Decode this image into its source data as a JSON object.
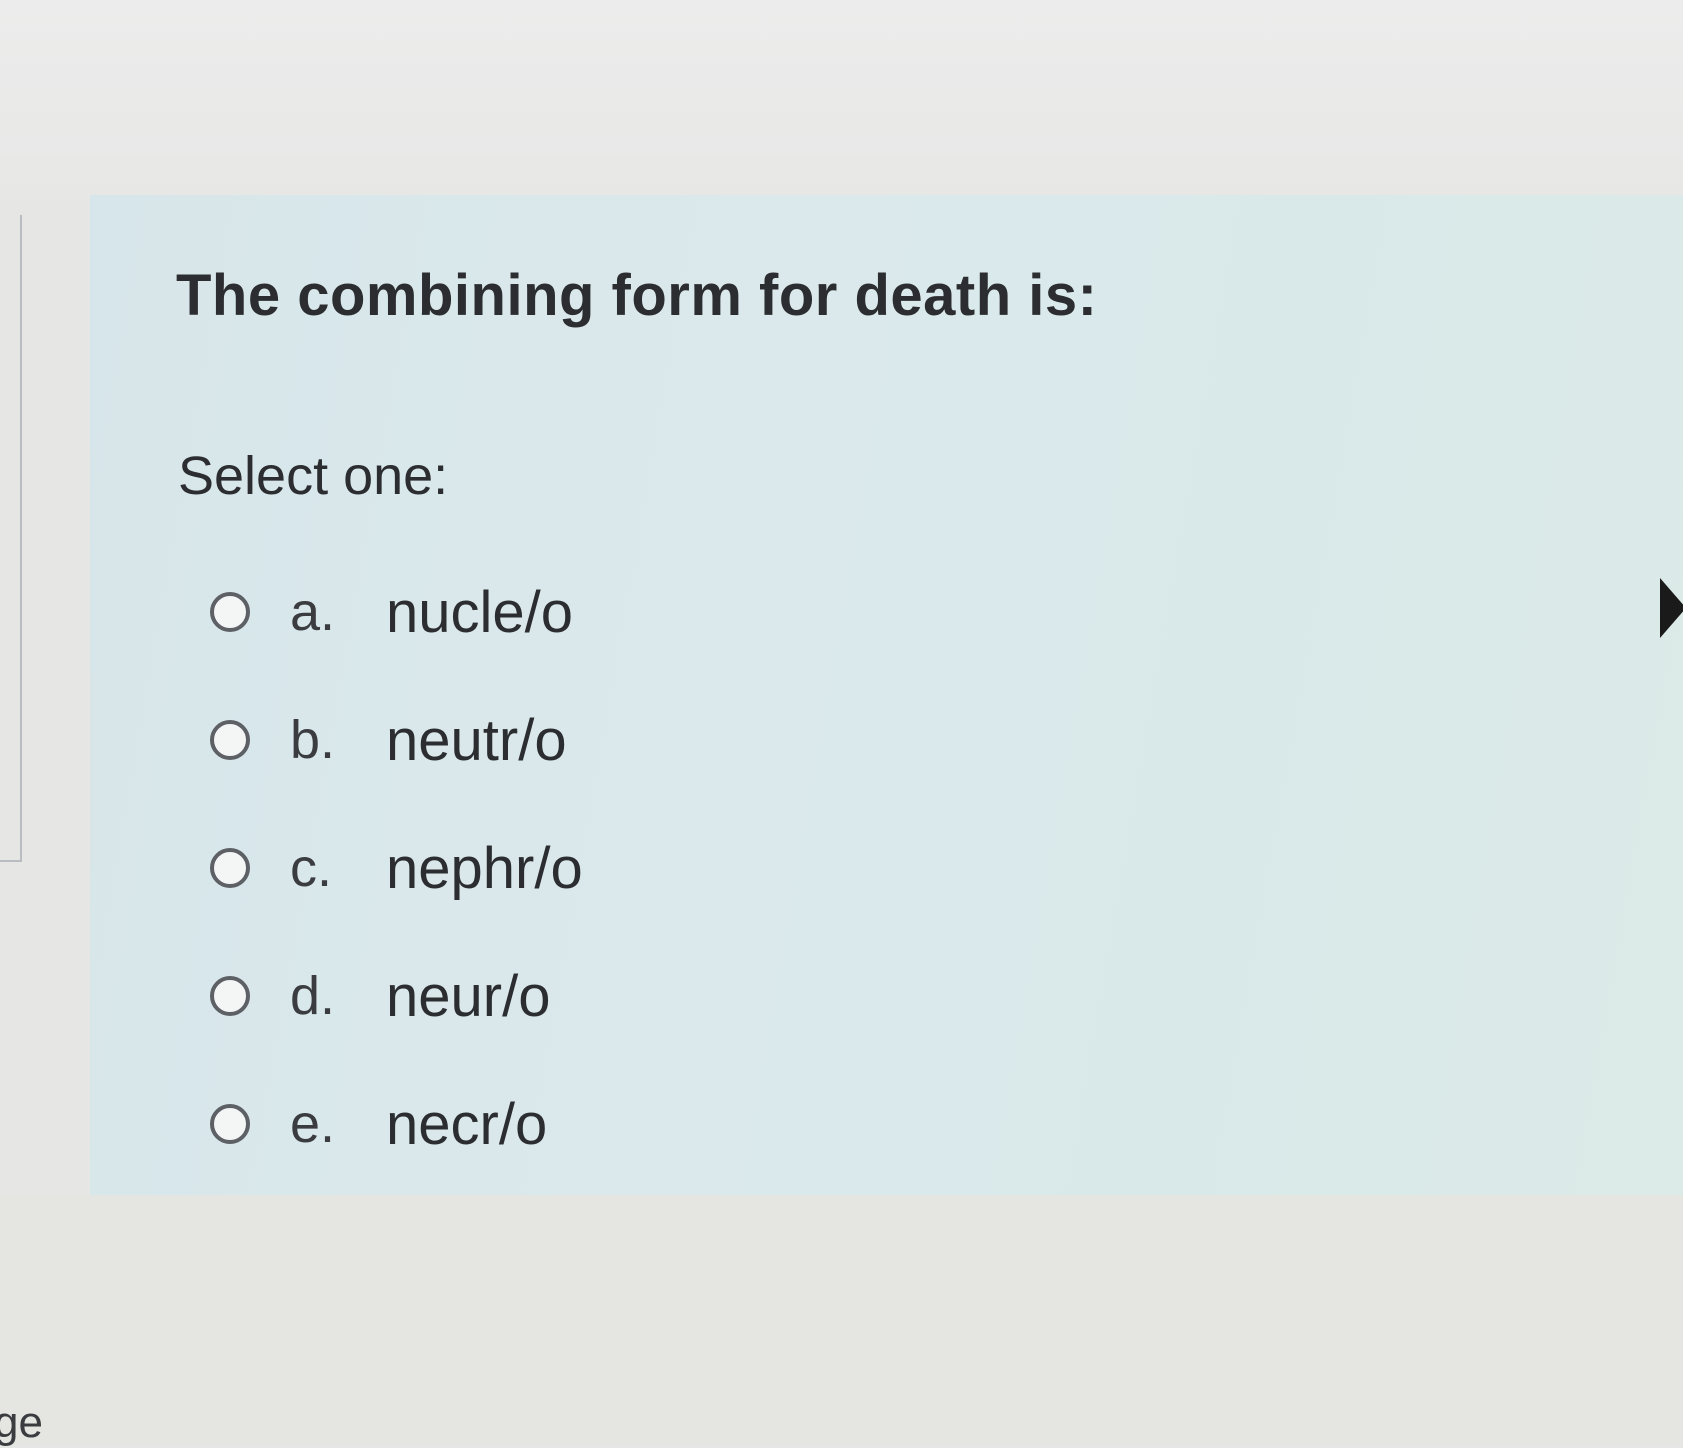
{
  "question": {
    "text": "The combining form for death is:",
    "prompt": "Select one:",
    "options": [
      {
        "letter": "a.",
        "text": "nucle/o",
        "selected": false
      },
      {
        "letter": "b.",
        "text": "neutr/o",
        "selected": false
      },
      {
        "letter": "c.",
        "text": "nephr/o",
        "selected": false
      },
      {
        "letter": "d.",
        "text": "neur/o",
        "selected": false
      },
      {
        "letter": "e.",
        "text": "necr/o",
        "selected": false
      }
    ]
  },
  "footer": {
    "fragment": "ge"
  },
  "icons": {
    "radio": "radio-unchecked-icon",
    "cursor": "mouse-cursor-icon"
  },
  "colors": {
    "panel_background": "#d9e8ea",
    "page_background": "#e6e7e4",
    "text": "#2b2d30"
  }
}
